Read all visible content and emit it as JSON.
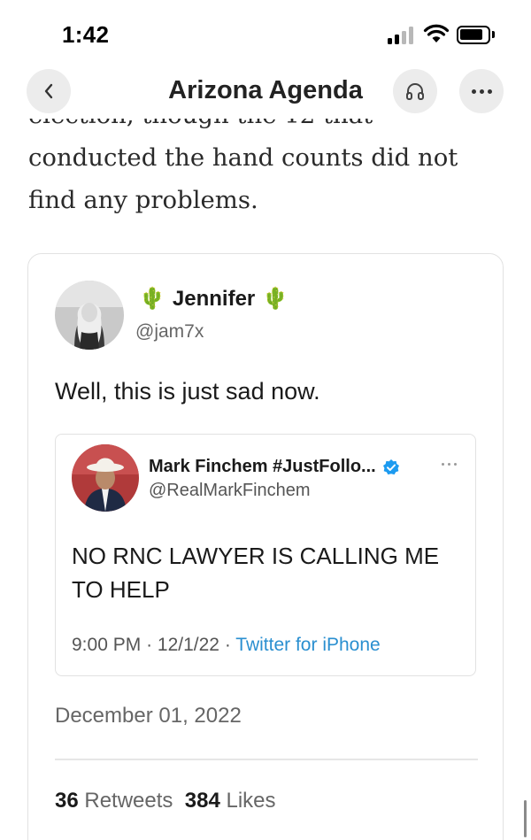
{
  "status_bar": {
    "time": "1:42",
    "icons": [
      "signal-icon",
      "wifi-icon",
      "battery-icon"
    ]
  },
  "nav": {
    "title": "Arizona Agenda",
    "back_icon": "chevron-left-icon",
    "audio_icon": "headphones-icon",
    "more_icon": "more-icon"
  },
  "article": {
    "lines": [
      "election, though the 12 that",
      "conducted the hand counts did not",
      "find any problems."
    ]
  },
  "tweet": {
    "author_name": "Jennifer",
    "author_emoji": "🌵",
    "handle": "@jam7x",
    "text": "Well, this is just sad now.",
    "quote": {
      "author_name": "Mark Finchem #JustFollo...",
      "handle": "@RealMarkFinchem",
      "verified": true,
      "text": "NO RNC LAWYER IS CALLING ME TO HELP",
      "time": "9:00 PM",
      "date": "12/1/22",
      "separator": "·",
      "source": "Twitter for iPhone"
    },
    "date": "December 01, 2022",
    "retweets": "36",
    "retweets_label": "Retweets",
    "likes": "384",
    "likes_label": "Likes"
  },
  "colors": {
    "link_blue": "#2a8fd0",
    "verified_blue": "#1d9bf0",
    "nav_button_bg": "#ececec",
    "muted_text": "#666666"
  }
}
